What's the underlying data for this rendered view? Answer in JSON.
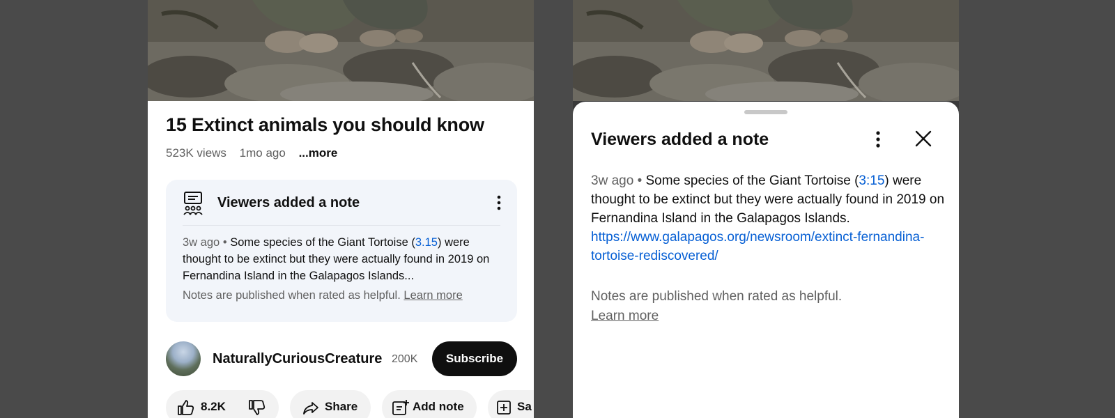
{
  "colors": {
    "background": "#4a4a4a",
    "link": "#065fd4",
    "subscribe_bg": "#0f0f0f"
  },
  "left": {
    "video_title": "15 Extinct animals you should know",
    "views": "523K views",
    "age": "1mo ago",
    "more": "...more",
    "note_card": {
      "icon": "notes-icon",
      "title": "Viewers added a note",
      "time": "3w ago",
      "separator": "•",
      "text_1": "Some species of the Giant Tortoise (",
      "timestamp": "3.15",
      "text_2": ") were thought to be extinct but they were actually found in 2019 on Fernandina Island in the Galapagos Islands...",
      "footer": "Notes are published when rated as helpful.",
      "learn_more": "Learn more"
    },
    "channel": {
      "name": "NaturallyCuriousCreature",
      "subscribers": "200K",
      "subscribe": "Subscribe"
    },
    "actions": {
      "likes": "8.2K",
      "share": "Share",
      "add_note": "Add note",
      "save": "Sa"
    }
  },
  "right": {
    "title": "Viewers added a note",
    "time": "3w ago",
    "separator": "•",
    "text_1": "Some species of the Giant Tortoise (",
    "timestamp": "3:15",
    "text_2": ") were thought to be extinct but they were actually found in 2019 on Fernandina Island in the Galapagos Islands. ",
    "url": "https://www.galapagos.org/newsroom/extinct-fernandina-tortoise-rediscovered/",
    "footer": "Notes are published when rated as helpful.",
    "learn_more": "Learn more"
  }
}
